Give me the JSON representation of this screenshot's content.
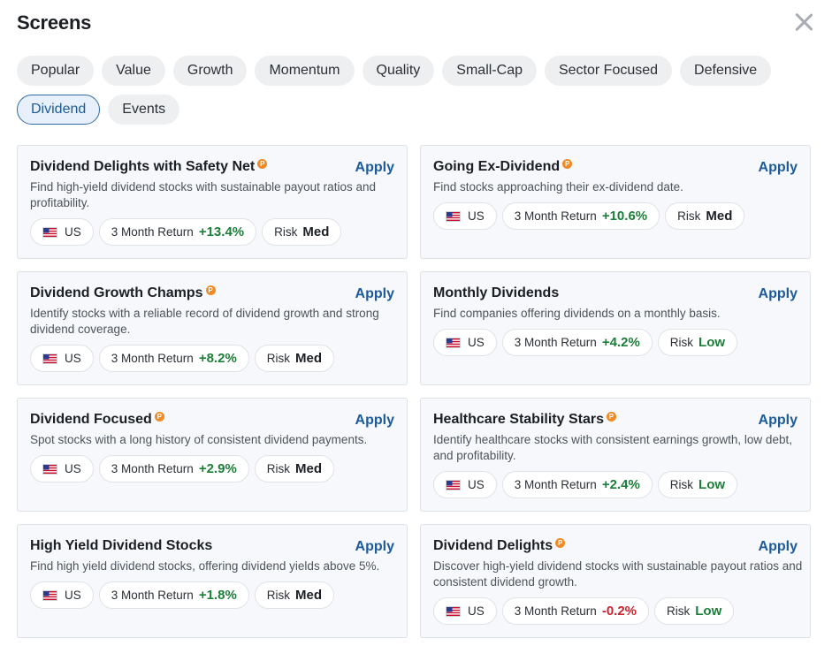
{
  "header": {
    "title": "Screens"
  },
  "tabs": [
    {
      "label": "Popular",
      "active": false
    },
    {
      "label": "Value",
      "active": false
    },
    {
      "label": "Growth",
      "active": false
    },
    {
      "label": "Momentum",
      "active": false
    },
    {
      "label": "Quality",
      "active": false
    },
    {
      "label": "Small-Cap",
      "active": false
    },
    {
      "label": "Sector Focused",
      "active": false
    },
    {
      "label": "Defensive",
      "active": false
    },
    {
      "label": "Dividend",
      "active": true
    },
    {
      "label": "Events",
      "active": false
    }
  ],
  "common": {
    "apply_label": "Apply",
    "return_label": "3 Month Return",
    "risk_label": "Risk"
  },
  "cards": [
    {
      "title": "Dividend Delights with Safety Net",
      "premium": true,
      "desc": "Find high-yield dividend stocks with sustainable payout ratios and profitability.",
      "region": "US",
      "return": "+13.4%",
      "return_dir": "pos",
      "risk": "Med"
    },
    {
      "title": "Going Ex-Dividend",
      "premium": true,
      "desc": "Find stocks approaching their ex-dividend date.",
      "region": "US",
      "return": "+10.6%",
      "return_dir": "pos",
      "risk": "Med"
    },
    {
      "title": "Dividend Growth Champs",
      "premium": true,
      "desc": "Identify stocks with a reliable record of dividend growth and strong dividend coverage.",
      "region": "US",
      "return": "+8.2%",
      "return_dir": "pos",
      "risk": "Med"
    },
    {
      "title": "Monthly Dividends",
      "premium": false,
      "desc": "Find companies offering dividends on a monthly basis.",
      "region": "US",
      "return": "+4.2%",
      "return_dir": "pos",
      "risk": "Low"
    },
    {
      "title": "Dividend Focused",
      "premium": true,
      "desc": "Spot stocks with a long history of consistent dividend payments.",
      "region": "US",
      "return": "+2.9%",
      "return_dir": "pos",
      "risk": "Med"
    },
    {
      "title": "Healthcare Stability Stars",
      "premium": true,
      "desc": "Identify healthcare stocks with consistent earnings growth, low debt, and profitability.",
      "region": "US",
      "return": "+2.4%",
      "return_dir": "pos",
      "risk": "Low"
    },
    {
      "title": "High Yield Dividend Stocks",
      "premium": false,
      "desc": "Find high yield dividend stocks, offering dividend yields above 5%.",
      "region": "US",
      "return": "+1.8%",
      "return_dir": "pos",
      "risk": "Med"
    },
    {
      "title": "Dividend Delights",
      "premium": true,
      "desc": "Discover high-yield dividend stocks with sustainable payout ratios and consistent dividend growth.",
      "region": "US",
      "return": "-0.2%",
      "return_dir": "neg",
      "risk": "Low"
    }
  ],
  "colors": {
    "accent": "#1d5a99",
    "positive": "#1a7f37",
    "negative": "#cf222e",
    "premium_badge": "#f08a24"
  },
  "icons": {
    "close": "close-icon",
    "premium": "premium-badge-icon",
    "flag": "us-flag-icon"
  }
}
